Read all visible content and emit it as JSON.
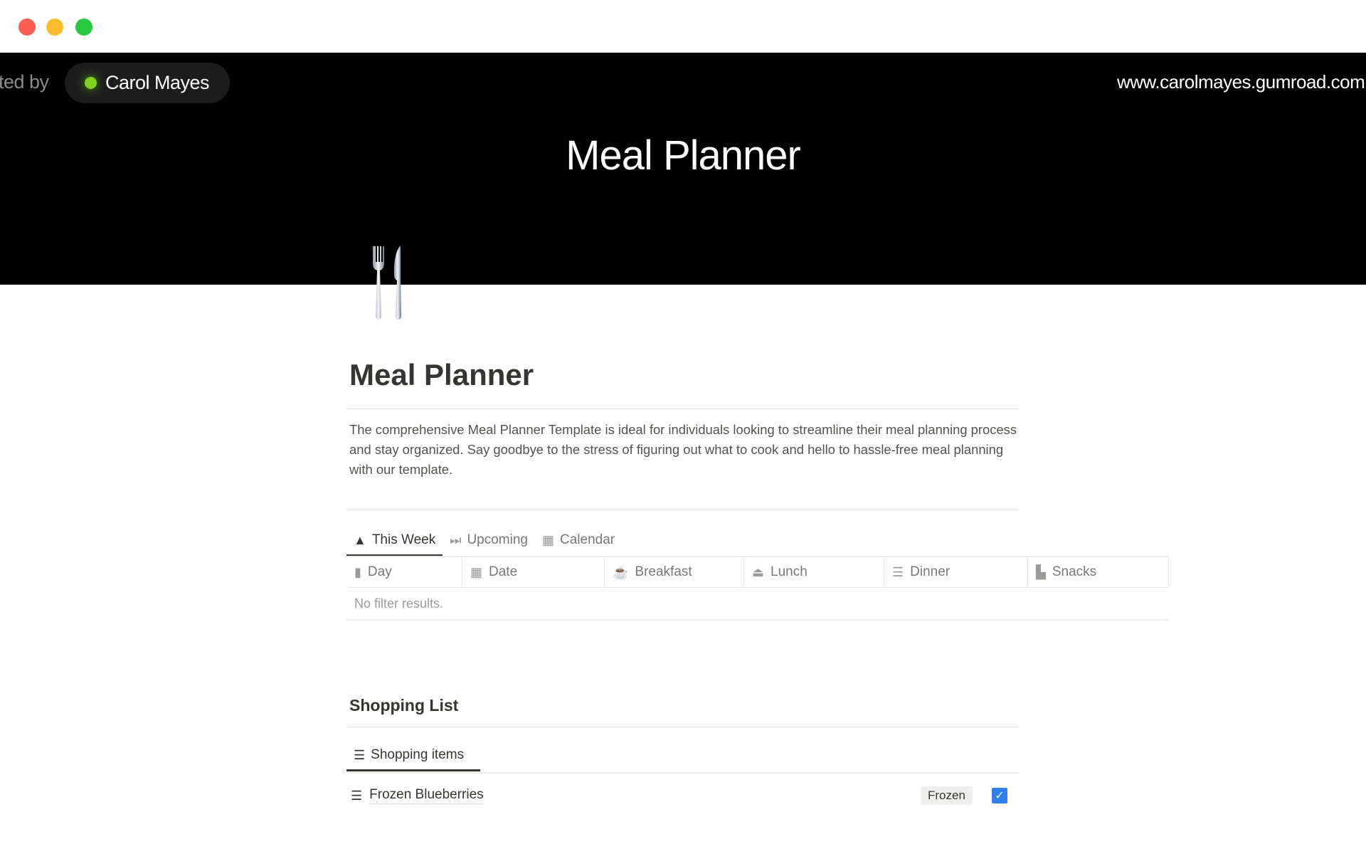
{
  "window": {
    "controls": [
      {
        "name": "close",
        "color": "#ff5f57"
      },
      {
        "name": "minimize",
        "color": "#febc2e"
      },
      {
        "name": "maximize",
        "color": "#28c840"
      }
    ]
  },
  "banner": {
    "byline": "ted by",
    "author": "Carol Mayes",
    "url": "www.carolmayes.gumroad.com",
    "title": "Meal Planner"
  },
  "page": {
    "icon": "fork-and-knife-icon",
    "title": "Meal Planner",
    "description": "The comprehensive Meal Planner Template is ideal for individuals looking to streamline their meal planning process and stay organized. Say goodbye to the stress of figuring out what to cook and hello to hassle-free meal planning with our template."
  },
  "meal_views": {
    "tabs": [
      {
        "label": "This Week",
        "icon": "warning-icon",
        "active": true
      },
      {
        "label": "Upcoming",
        "icon": "fast-forward-icon"
      },
      {
        "label": "Calendar",
        "icon": "calendar-icon"
      }
    ],
    "columns": [
      {
        "label": "Day",
        "icon": "calendar-day-icon"
      },
      {
        "label": "Date",
        "icon": "calendar-icon"
      },
      {
        "label": "Breakfast",
        "icon": "coffee-icon"
      },
      {
        "label": "Lunch",
        "icon": "plate-icon"
      },
      {
        "label": "Dinner",
        "icon": "burger-icon"
      },
      {
        "label": "Snacks",
        "icon": "snack-icon"
      }
    ],
    "empty_text": "No filter results."
  },
  "shopping": {
    "heading": "Shopping List",
    "tab": "Shopping items",
    "items": [
      {
        "name": "Frozen Blueberries",
        "tag": "Frozen",
        "checked": true
      }
    ]
  },
  "colors": {
    "accent": "#2f80ed",
    "banner": "#000000",
    "status_dot": "#7ed321"
  }
}
